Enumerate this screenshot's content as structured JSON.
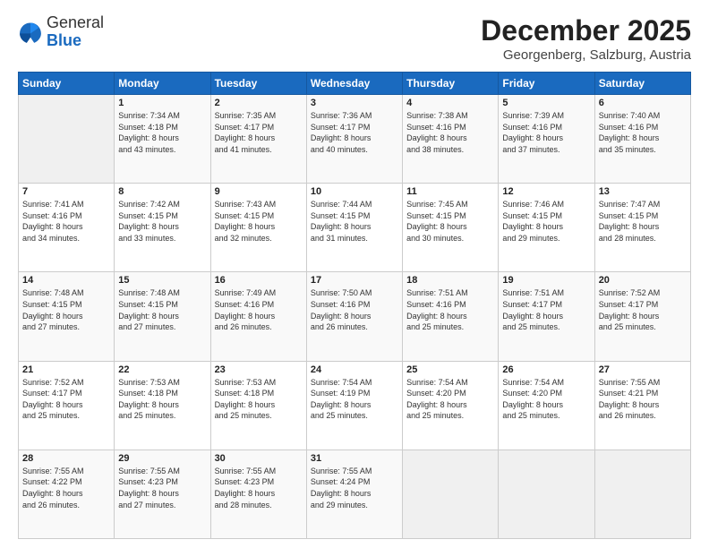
{
  "logo": {
    "general": "General",
    "blue": "Blue"
  },
  "header": {
    "month": "December 2025",
    "location": "Georgenberg, Salzburg, Austria"
  },
  "weekdays": [
    "Sunday",
    "Monday",
    "Tuesday",
    "Wednesday",
    "Thursday",
    "Friday",
    "Saturday"
  ],
  "weeks": [
    [
      {
        "day": "",
        "info": ""
      },
      {
        "day": "1",
        "info": "Sunrise: 7:34 AM\nSunset: 4:18 PM\nDaylight: 8 hours\nand 43 minutes."
      },
      {
        "day": "2",
        "info": "Sunrise: 7:35 AM\nSunset: 4:17 PM\nDaylight: 8 hours\nand 41 minutes."
      },
      {
        "day": "3",
        "info": "Sunrise: 7:36 AM\nSunset: 4:17 PM\nDaylight: 8 hours\nand 40 minutes."
      },
      {
        "day": "4",
        "info": "Sunrise: 7:38 AM\nSunset: 4:16 PM\nDaylight: 8 hours\nand 38 minutes."
      },
      {
        "day": "5",
        "info": "Sunrise: 7:39 AM\nSunset: 4:16 PM\nDaylight: 8 hours\nand 37 minutes."
      },
      {
        "day": "6",
        "info": "Sunrise: 7:40 AM\nSunset: 4:16 PM\nDaylight: 8 hours\nand 35 minutes."
      }
    ],
    [
      {
        "day": "7",
        "info": "Sunrise: 7:41 AM\nSunset: 4:16 PM\nDaylight: 8 hours\nand 34 minutes."
      },
      {
        "day": "8",
        "info": "Sunrise: 7:42 AM\nSunset: 4:15 PM\nDaylight: 8 hours\nand 33 minutes."
      },
      {
        "day": "9",
        "info": "Sunrise: 7:43 AM\nSunset: 4:15 PM\nDaylight: 8 hours\nand 32 minutes."
      },
      {
        "day": "10",
        "info": "Sunrise: 7:44 AM\nSunset: 4:15 PM\nDaylight: 8 hours\nand 31 minutes."
      },
      {
        "day": "11",
        "info": "Sunrise: 7:45 AM\nSunset: 4:15 PM\nDaylight: 8 hours\nand 30 minutes."
      },
      {
        "day": "12",
        "info": "Sunrise: 7:46 AM\nSunset: 4:15 PM\nDaylight: 8 hours\nand 29 minutes."
      },
      {
        "day": "13",
        "info": "Sunrise: 7:47 AM\nSunset: 4:15 PM\nDaylight: 8 hours\nand 28 minutes."
      }
    ],
    [
      {
        "day": "14",
        "info": "Sunrise: 7:48 AM\nSunset: 4:15 PM\nDaylight: 8 hours\nand 27 minutes."
      },
      {
        "day": "15",
        "info": "Sunrise: 7:48 AM\nSunset: 4:15 PM\nDaylight: 8 hours\nand 27 minutes."
      },
      {
        "day": "16",
        "info": "Sunrise: 7:49 AM\nSunset: 4:16 PM\nDaylight: 8 hours\nand 26 minutes."
      },
      {
        "day": "17",
        "info": "Sunrise: 7:50 AM\nSunset: 4:16 PM\nDaylight: 8 hours\nand 26 minutes."
      },
      {
        "day": "18",
        "info": "Sunrise: 7:51 AM\nSunset: 4:16 PM\nDaylight: 8 hours\nand 25 minutes."
      },
      {
        "day": "19",
        "info": "Sunrise: 7:51 AM\nSunset: 4:17 PM\nDaylight: 8 hours\nand 25 minutes."
      },
      {
        "day": "20",
        "info": "Sunrise: 7:52 AM\nSunset: 4:17 PM\nDaylight: 8 hours\nand 25 minutes."
      }
    ],
    [
      {
        "day": "21",
        "info": "Sunrise: 7:52 AM\nSunset: 4:17 PM\nDaylight: 8 hours\nand 25 minutes."
      },
      {
        "day": "22",
        "info": "Sunrise: 7:53 AM\nSunset: 4:18 PM\nDaylight: 8 hours\nand 25 minutes."
      },
      {
        "day": "23",
        "info": "Sunrise: 7:53 AM\nSunset: 4:18 PM\nDaylight: 8 hours\nand 25 minutes."
      },
      {
        "day": "24",
        "info": "Sunrise: 7:54 AM\nSunset: 4:19 PM\nDaylight: 8 hours\nand 25 minutes."
      },
      {
        "day": "25",
        "info": "Sunrise: 7:54 AM\nSunset: 4:20 PM\nDaylight: 8 hours\nand 25 minutes."
      },
      {
        "day": "26",
        "info": "Sunrise: 7:54 AM\nSunset: 4:20 PM\nDaylight: 8 hours\nand 25 minutes."
      },
      {
        "day": "27",
        "info": "Sunrise: 7:55 AM\nSunset: 4:21 PM\nDaylight: 8 hours\nand 26 minutes."
      }
    ],
    [
      {
        "day": "28",
        "info": "Sunrise: 7:55 AM\nSunset: 4:22 PM\nDaylight: 8 hours\nand 26 minutes."
      },
      {
        "day": "29",
        "info": "Sunrise: 7:55 AM\nSunset: 4:23 PM\nDaylight: 8 hours\nand 27 minutes."
      },
      {
        "day": "30",
        "info": "Sunrise: 7:55 AM\nSunset: 4:23 PM\nDaylight: 8 hours\nand 28 minutes."
      },
      {
        "day": "31",
        "info": "Sunrise: 7:55 AM\nSunset: 4:24 PM\nDaylight: 8 hours\nand 29 minutes."
      },
      {
        "day": "",
        "info": ""
      },
      {
        "day": "",
        "info": ""
      },
      {
        "day": "",
        "info": ""
      }
    ]
  ]
}
